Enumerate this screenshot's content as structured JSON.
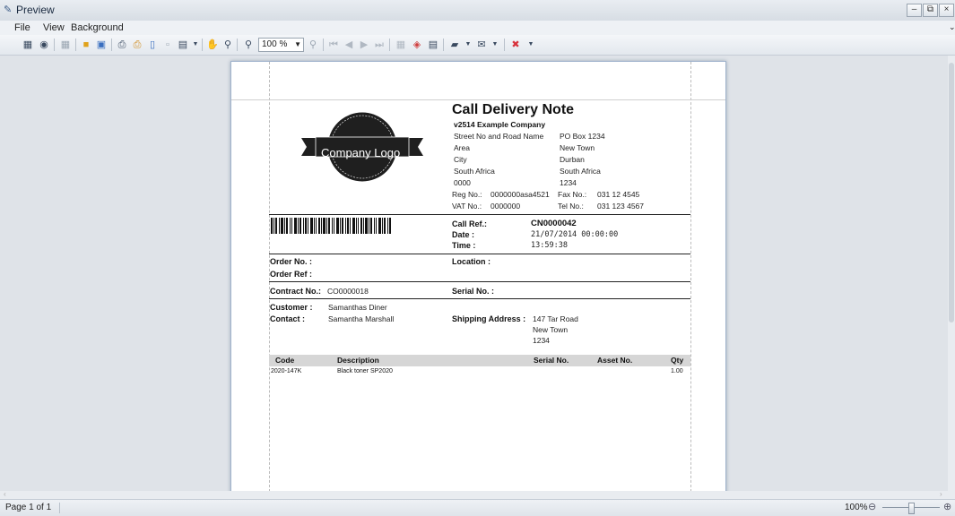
{
  "window": {
    "title": "Preview"
  },
  "menu": {
    "items": [
      "File",
      "View",
      "Background"
    ]
  },
  "toolbar": {
    "zoom_value": "100 %"
  },
  "document": {
    "title": "Call Delivery Note",
    "logo_text": "Company Logo",
    "company_name": "v2514 Example Company",
    "address_left": [
      "Street No and Road Name",
      "Area",
      "City",
      "South Africa",
      "0000"
    ],
    "address_right": [
      "PO Box 1234",
      "New Town",
      "Durban",
      "South Africa",
      "1234"
    ],
    "reg_label": "Reg No.:",
    "reg_value": "0000000asa4521",
    "fax_label": "Fax No.:",
    "fax_value": "031 12 4545",
    "vat_label": "VAT No.:",
    "vat_value": "0000000",
    "tel_label": "Tel No.:",
    "tel_value": "031 123 4567",
    "call_ref_label": "Call Ref.:",
    "call_ref_value": "CN0000042",
    "date_label": "Date :",
    "date_value": "21/07/2014 00:00:00",
    "time_label": "Time :",
    "time_value": "13:59:38",
    "order_no_label": "Order No. :",
    "order_ref_label": "Order Ref :",
    "location_label": "Location :",
    "contract_label": "Contract No.:",
    "contract_value": "CO0000018",
    "serial_label": "Serial No. :",
    "customer_label": "Customer :",
    "customer_value": "Samanthas Diner",
    "contact_label": "Contact :",
    "contact_value": "Samantha Marshall",
    "shipping_label": "Shipping Address :",
    "shipping_lines": [
      "147 Tar Road",
      "New Town",
      "1234"
    ],
    "table_headers": [
      "Code",
      "Description",
      "Serial No.",
      "Asset No.",
      "Qty"
    ],
    "rows": [
      {
        "code": "2020-147K",
        "description": "Black toner SP2020",
        "serial": "",
        "asset": "",
        "qty": "1.00"
      }
    ]
  },
  "status": {
    "page": "Page 1 of 1",
    "zoom": "100%"
  }
}
